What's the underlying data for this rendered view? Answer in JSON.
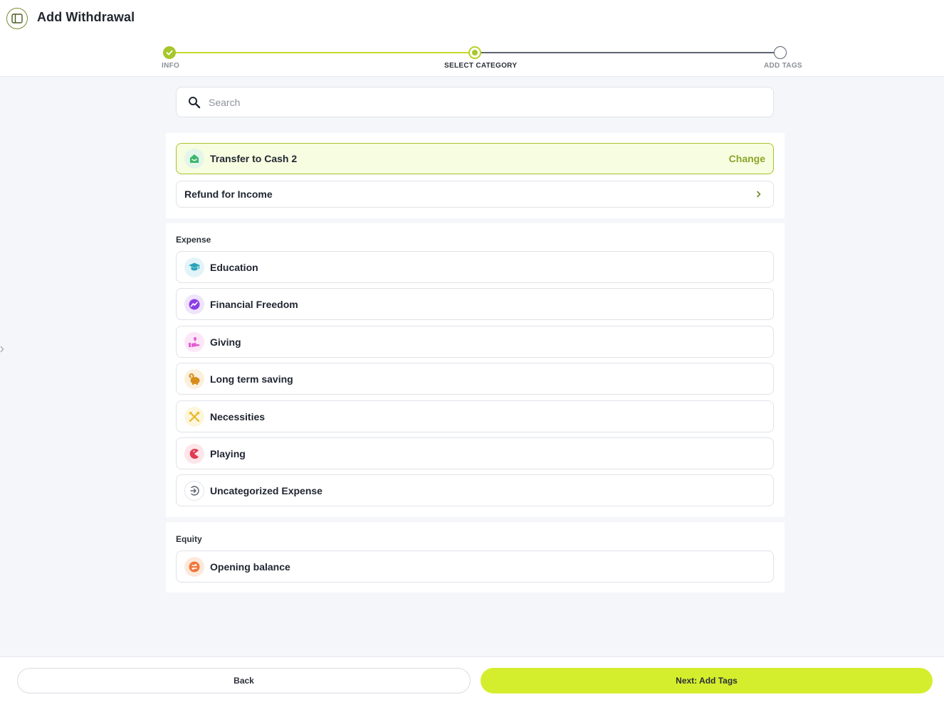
{
  "header": {
    "title": "Add Withdrawal"
  },
  "stepper": {
    "steps": [
      {
        "label": "INFO",
        "state": "done"
      },
      {
        "label": "SELECT CATEGORY",
        "state": "current"
      },
      {
        "label": "ADD TAGS",
        "state": "todo"
      }
    ]
  },
  "search": {
    "placeholder": "Search",
    "value": ""
  },
  "top": {
    "selected": {
      "label": "Transfer to Cash 2",
      "action": "Change",
      "icon": "house-wallet-icon",
      "color": "#39b86b"
    },
    "refund": {
      "label": "Refund for Income",
      "icon": "chevron-right-icon"
    }
  },
  "expense": {
    "title": "Expense",
    "items": [
      {
        "label": "Education",
        "icon": "graduation-cap-icon",
        "color": "#2aa3bd"
      },
      {
        "label": "Financial Freedom",
        "icon": "trend-up-icon",
        "color": "#8b3ee6"
      },
      {
        "label": "Giving",
        "icon": "giving-hand-icon",
        "color": "#e35bd1"
      },
      {
        "label": "Long term saving",
        "icon": "piggy-bank-icon",
        "color": "#d98c1a"
      },
      {
        "label": "Necessities",
        "icon": "fork-knife-icon",
        "color": "#e8b820"
      },
      {
        "label": "Playing",
        "icon": "pacman-icon",
        "color": "#e23b54"
      },
      {
        "label": "Uncategorized Expense",
        "icon": "arrow-in-circle-icon",
        "color": "#5c6470"
      }
    ]
  },
  "equity": {
    "title": "Equity",
    "items": [
      {
        "label": "Opening balance",
        "icon": "swap-icon",
        "color": "#f0773a"
      }
    ]
  },
  "footer": {
    "back_label": "Back",
    "next_label": "Next: Add Tags"
  },
  "colors": {
    "accent": "#d4ee2d",
    "accent_dark": "#a6c72a",
    "selected_bg": "#f7fde0"
  }
}
